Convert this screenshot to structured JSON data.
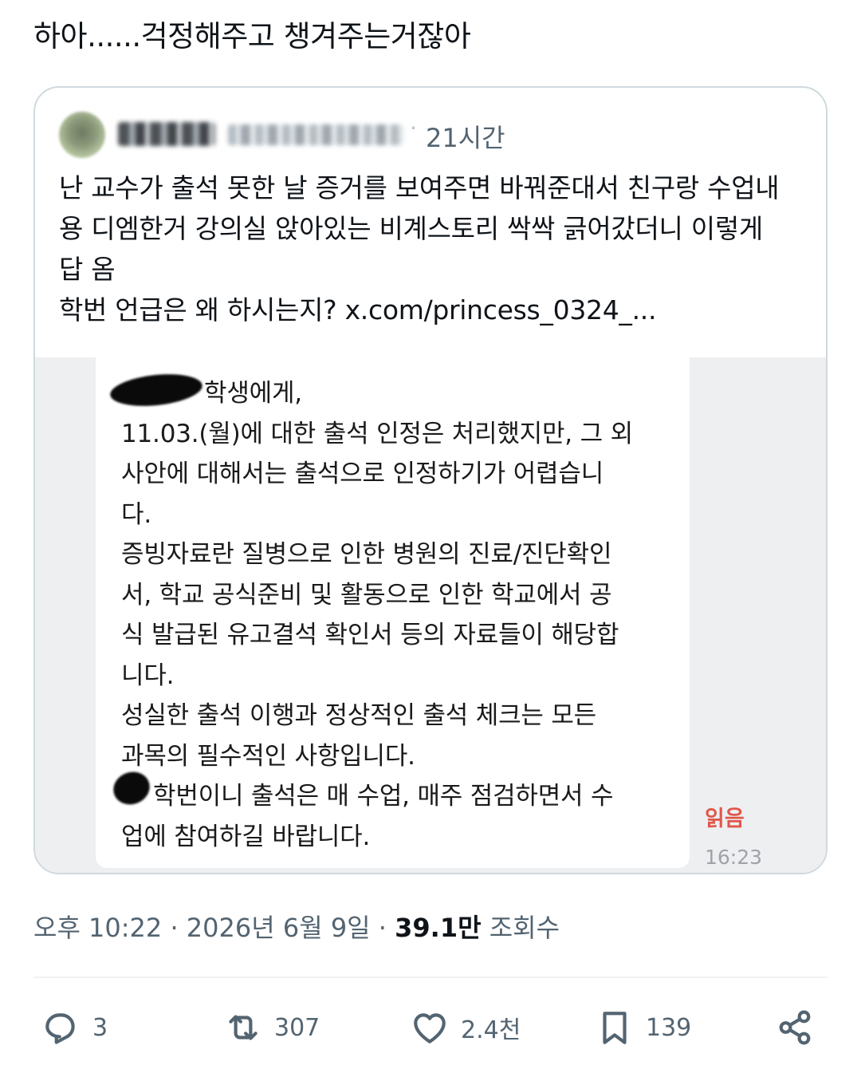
{
  "tweet": {
    "text": "하아......걱정해주고 챙겨주는거잖아"
  },
  "quote": {
    "time": "21시간",
    "body_lines": [
      "난 교수가 출석 못한 날 증거를 보여주면 바꿔준대서 친구랑 수업내",
      "용 디엠한거 강의실 앉아있는 비계스토리 싹싹 긁어갔더니 이렇게",
      "답 옴",
      "학번 언급은 왜 하시는지?  x.com/princess_0324_..."
    ]
  },
  "chat": {
    "lines": [
      "학생에게,",
      "11.03.(월)에 대한 출석 인정은 처리했지만, 그 외",
      "사안에 대해서는 출석으로 인정하기가 어렵습니",
      "다.",
      "증빙자료란 질병으로 인한 병원의 진료/진단확인",
      "서, 학교 공식준비 및 활동으로 인한 학교에서 공",
      "식 발급된 유고결석 확인서 등의 자료들이 해당합",
      "니다.",
      "성실한 출석 이행과 정상적인 출석 체크는 모든",
      "과목의 필수적인 사항입니다.",
      "학번이니 출석은 매 수업, 매주 점검하면서 수",
      "업에 참여하길 바랍니다."
    ],
    "read_label": "읽음",
    "time": "16:23"
  },
  "meta": {
    "time": "오후 10:22",
    "sep1": " · ",
    "date": "2026년 6월 9일",
    "sep2": " · ",
    "views_count": "39.1만",
    "views_label": " 조회수"
  },
  "actions": {
    "replies": "3",
    "retweets": "307",
    "likes": "2.4천",
    "bookmarks": "139"
  },
  "icons": {
    "reply": "reply-icon",
    "retweet": "retweet-icon",
    "like": "heart-icon",
    "bookmark": "bookmark-icon",
    "share": "share-icon"
  },
  "colors": {
    "text": "#0f1419",
    "secondary": "#536471",
    "border": "#cfd9de",
    "read_mark": "#e0574b"
  }
}
